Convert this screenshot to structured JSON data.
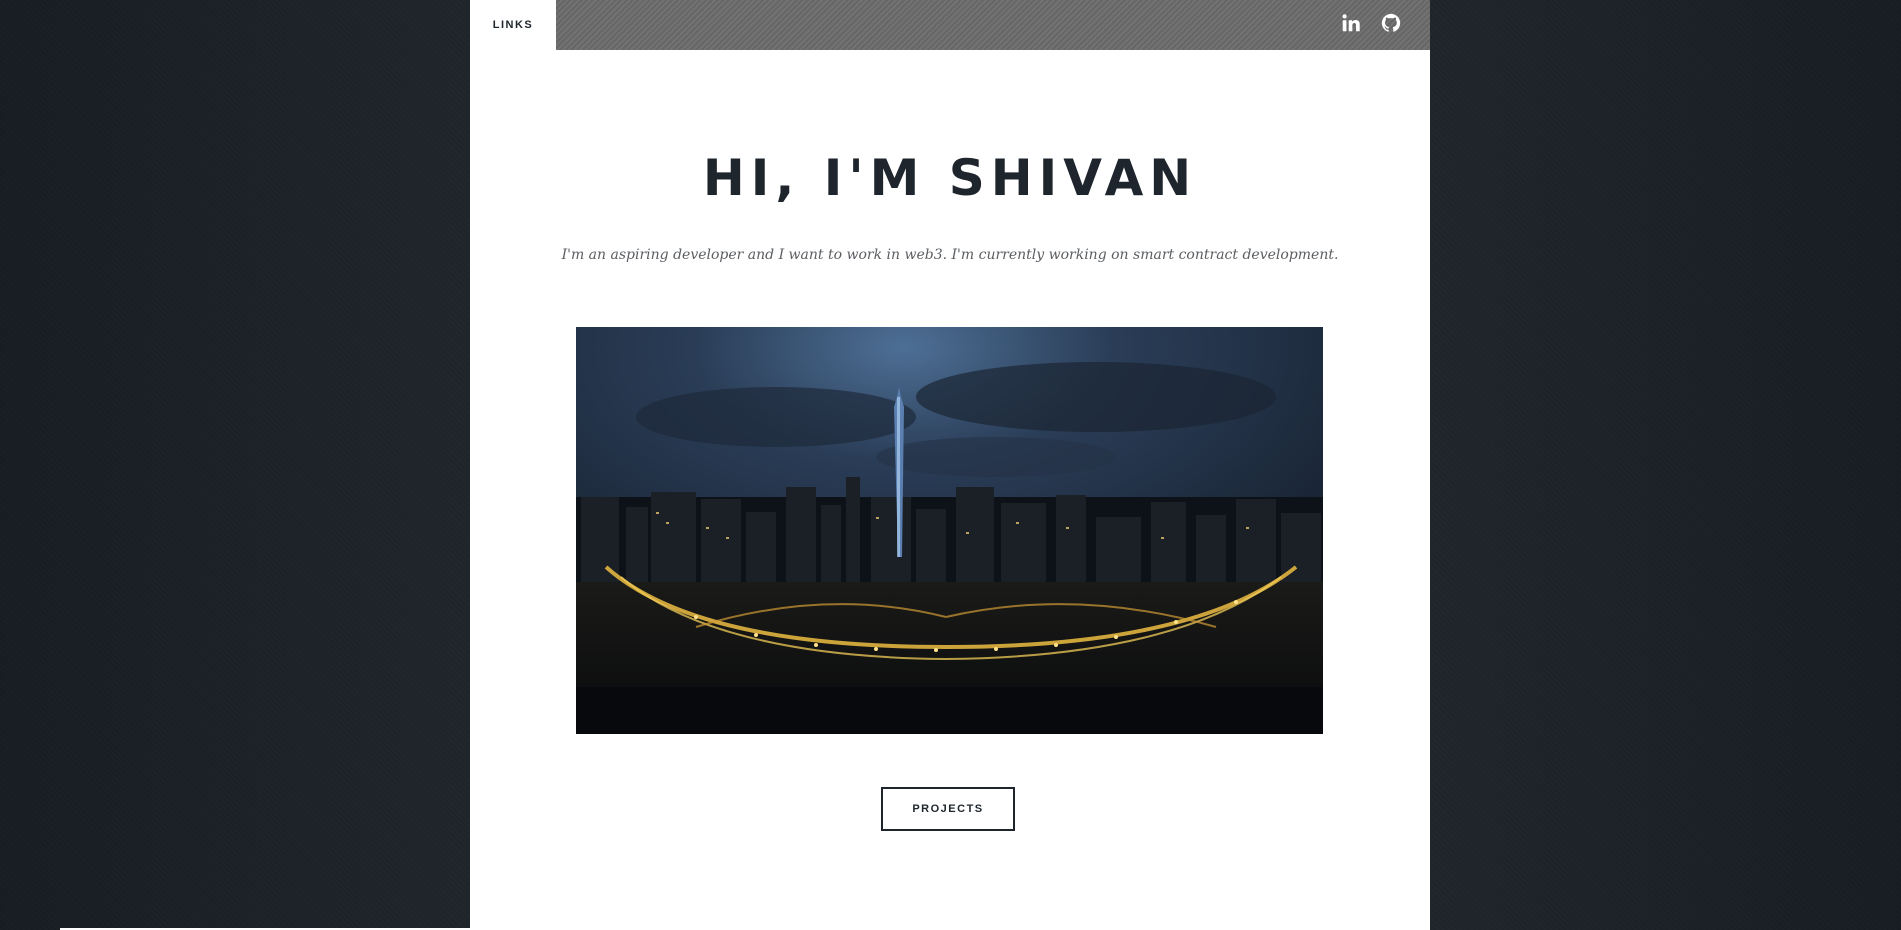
{
  "nav": {
    "links_label": "LINKS",
    "social": [
      {
        "icon": "linkedin-icon"
      },
      {
        "icon": "github-icon"
      }
    ]
  },
  "intro": {
    "title": "HI, I'M SHIVAN",
    "subtitle": "I'm an aspiring developer and I want to work in web3. I'm currently working on smart contract development."
  },
  "cta": {
    "projects_label": "PROJECTS"
  },
  "colors": {
    "background": "#1f262d",
    "text_dark": "#1e252d",
    "topbar": "#6b6b6b"
  }
}
